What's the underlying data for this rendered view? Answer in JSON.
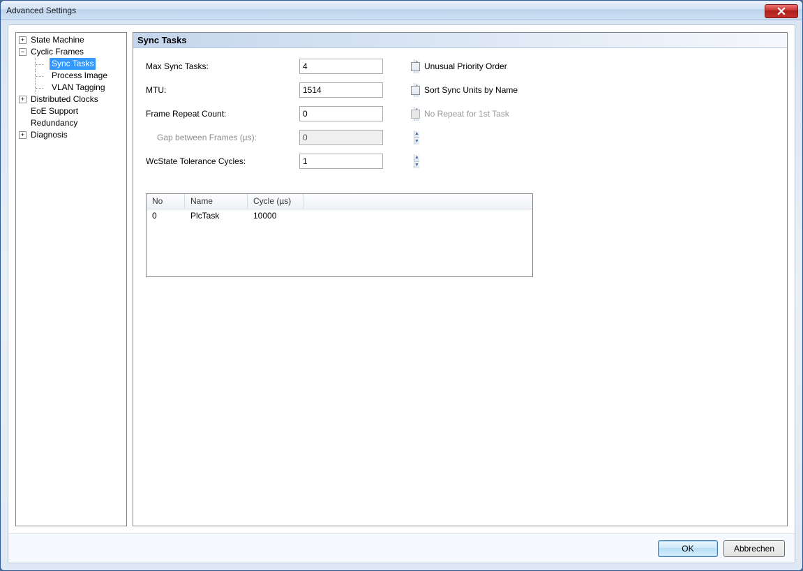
{
  "window": {
    "title": "Advanced Settings"
  },
  "tree": {
    "state_machine": "State Machine",
    "cyclic_frames": "Cyclic Frames",
    "sync_tasks": "Sync Tasks",
    "process_image": "Process Image",
    "vlan_tagging": "VLAN Tagging",
    "distributed_clocks": "Distributed Clocks",
    "eoe_support": "EoE Support",
    "redundancy": "Redundancy",
    "diagnosis": "Diagnosis"
  },
  "panel": {
    "header": "Sync Tasks",
    "max_sync_tasks_label": "Max Sync Tasks:",
    "max_sync_tasks_value": "4",
    "mtu_label": "MTU:",
    "mtu_value": "1514",
    "frame_repeat_label": "Frame Repeat Count:",
    "frame_repeat_value": "0",
    "gap_label": "Gap between Frames (µs):",
    "gap_value": "0",
    "wcstate_label": "WcState Tolerance Cycles:",
    "wcstate_value": "1",
    "unusual_priority": "Unusual Priority Order",
    "sort_sync_units": "Sort Sync Units by Name",
    "no_repeat": "No Repeat for 1st Task"
  },
  "table": {
    "headers": {
      "no": "No",
      "name": "Name",
      "cycle": "Cycle (µs)"
    },
    "rows": [
      {
        "no": "0",
        "name": "PlcTask",
        "cycle": "10000"
      }
    ]
  },
  "buttons": {
    "ok": "OK",
    "cancel": "Abbrechen"
  }
}
